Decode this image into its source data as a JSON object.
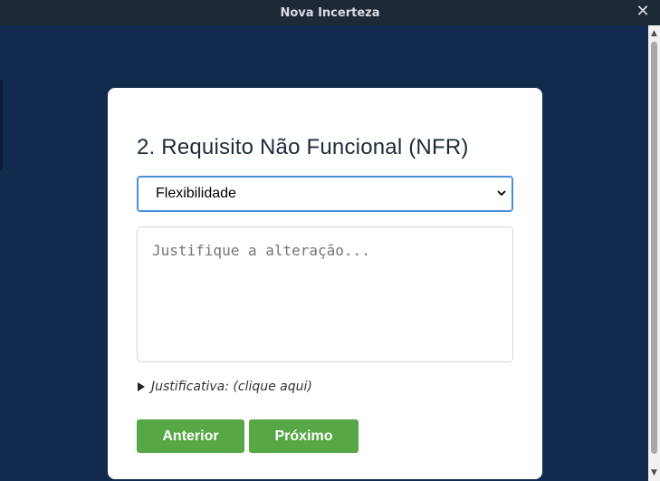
{
  "window": {
    "title": "Nova Incerteza",
    "close_icon": "close-icon"
  },
  "card": {
    "title": "2. Requisito Não Funcional (NFR)",
    "select": {
      "selected": "Flexibilidade",
      "icon": "chevron-down-icon"
    },
    "textarea": {
      "value": "",
      "placeholder": "Justifique a alteração..."
    },
    "details": {
      "summary": "Justificativa: (clique aqui)",
      "icon": "triangle-right-icon"
    },
    "buttons": {
      "previous": "Anterior",
      "next": "Próximo"
    }
  },
  "colors": {
    "background": "#112a4d",
    "titlebar": "#1e2936",
    "button": "#55a845",
    "select_border": "#4a90d9"
  }
}
